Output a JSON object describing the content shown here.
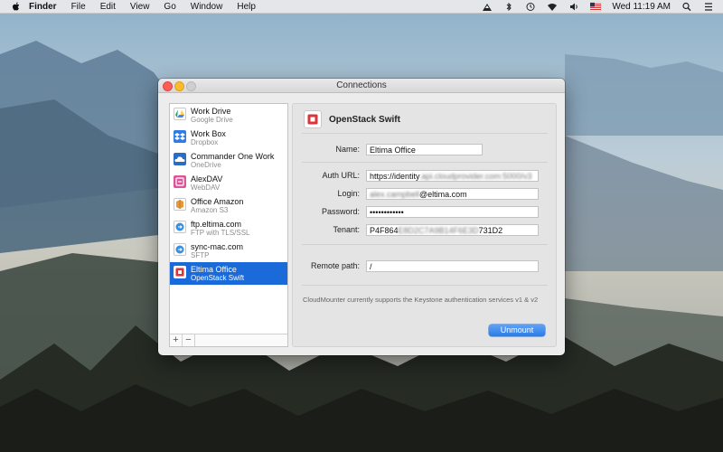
{
  "menubar": {
    "app": "Finder",
    "items": [
      "File",
      "Edit",
      "View",
      "Go",
      "Window",
      "Help"
    ],
    "clock": "Wed 11:19 AM"
  },
  "window": {
    "title": "Connections"
  },
  "accounts": [
    {
      "name": "Work Drive",
      "service": "Google Drive",
      "icon": "google-drive-icon",
      "color": "#3b8be5"
    },
    {
      "name": "Work Box",
      "service": "Dropbox",
      "icon": "dropbox-icon",
      "color": "#2d7de5"
    },
    {
      "name": "Commander One Work",
      "service": "OneDrive",
      "icon": "onedrive-icon",
      "color": "#2a6ec4"
    },
    {
      "name": "AlexDAV",
      "service": "WebDAV",
      "icon": "webdav-icon",
      "color": "#d9579a"
    },
    {
      "name": "Office Amazon",
      "service": "Amazon S3",
      "icon": "amazon-s3-icon",
      "color": "#e9973b"
    },
    {
      "name": "ftp.eltima.com",
      "service": "FTP with TLS/SSL",
      "icon": "ftp-icon",
      "color": "#3a90e0"
    },
    {
      "name": "sync-mac.com",
      "service": "SFTP",
      "icon": "sftp-icon",
      "color": "#3a90e0"
    },
    {
      "name": "Eltima Office",
      "service": "OpenStack Swift",
      "icon": "openstack-icon",
      "color": "#d8363a",
      "selected": true
    }
  ],
  "sidebar_buttons": {
    "add": "+",
    "remove": "−"
  },
  "detail": {
    "service_title": "OpenStack Swift",
    "fields": {
      "name": {
        "label": "Name:",
        "value": "Eltima Office"
      },
      "auth_url": {
        "label": "Auth URL:",
        "value": "https://identity",
        "hidden": ".api.cloudprovider.com:5000/v3"
      },
      "login": {
        "label": "Login:",
        "value_hidden": "alex.campbell",
        "value": "@eltima.com"
      },
      "password": {
        "label": "Password:",
        "value": "••••••••••••"
      },
      "tenant": {
        "label": "Tenant:",
        "value": "P4F864",
        "hidden": "E8D2C7A9B14F6E3D",
        "value_end": "731D2"
      },
      "remote_path": {
        "label": "Remote path:",
        "value": "/"
      }
    },
    "note": "CloudMounter currently supports the Keystone authentication services v1 & v2",
    "unmount_label": "Unmount"
  }
}
